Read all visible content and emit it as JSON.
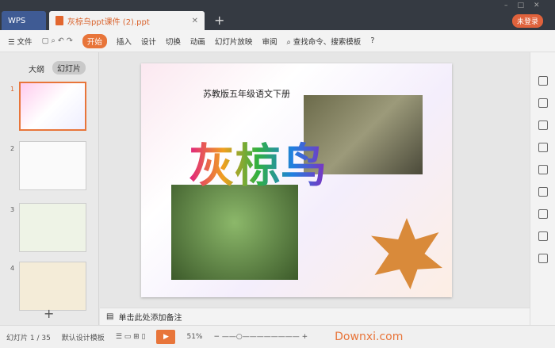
{
  "tabs": {
    "wps": "WPS",
    "doc": "灰椋鸟ppt课件 (2).ppt",
    "login": "未登录"
  },
  "toolbar": {
    "file": "文件",
    "items": [
      "开始",
      "插入",
      "设计",
      "切换",
      "动画",
      "幻灯片放映",
      "审阅"
    ],
    "search": "查找命令、搜索模板"
  },
  "panel": {
    "outline": "大纲",
    "slides": "幻灯片",
    "numbers": [
      "1",
      "2",
      "3",
      "4"
    ]
  },
  "slide": {
    "subtitle": "苏教版五年级语文下册",
    "title": "灰椋鸟"
  },
  "notes": {
    "placeholder": "单击此处添加备注"
  },
  "status": {
    "slide": "幻灯片 1 / 35",
    "template": "默认设计模板",
    "zoom": "51%",
    "watermark": "Downxi.com"
  }
}
